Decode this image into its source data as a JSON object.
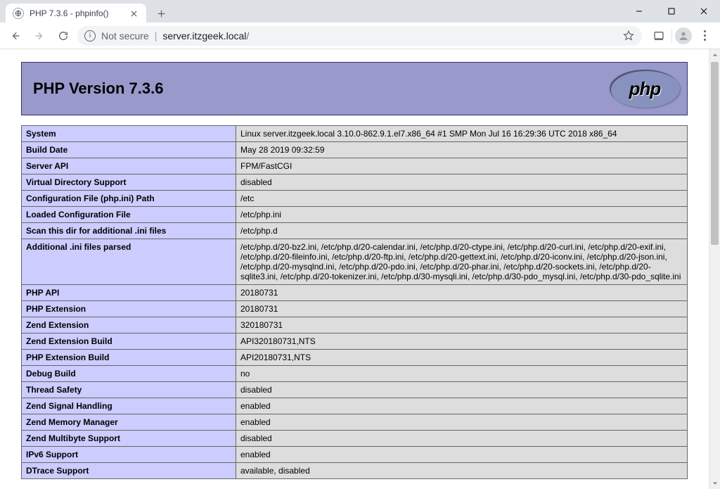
{
  "browser": {
    "tab_title": "PHP 7.3.6 - phpinfo()",
    "not_secure_label": "Not secure",
    "url_host": "server.itzgeek.local",
    "url_path": "/"
  },
  "page": {
    "header_title": "PHP Version 7.3.6",
    "logo_text": "php",
    "rows": [
      {
        "label": "System",
        "value": "Linux server.itzgeek.local 3.10.0-862.9.1.el7.x86_64 #1 SMP Mon Jul 16 16:29:36 UTC 2018 x86_64"
      },
      {
        "label": "Build Date",
        "value": "May 28 2019 09:32:59"
      },
      {
        "label": "Server API",
        "value": "FPM/FastCGI"
      },
      {
        "label": "Virtual Directory Support",
        "value": "disabled"
      },
      {
        "label": "Configuration File (php.ini) Path",
        "value": "/etc"
      },
      {
        "label": "Loaded Configuration File",
        "value": "/etc/php.ini"
      },
      {
        "label": "Scan this dir for additional .ini files",
        "value": "/etc/php.d"
      },
      {
        "label": "Additional .ini files parsed",
        "value": "/etc/php.d/20-bz2.ini, /etc/php.d/20-calendar.ini, /etc/php.d/20-ctype.ini, /etc/php.d/20-curl.ini, /etc/php.d/20-exif.ini, /etc/php.d/20-fileinfo.ini, /etc/php.d/20-ftp.ini, /etc/php.d/20-gettext.ini, /etc/php.d/20-iconv.ini, /etc/php.d/20-json.ini, /etc/php.d/20-mysqlnd.ini, /etc/php.d/20-pdo.ini, /etc/php.d/20-phar.ini, /etc/php.d/20-sockets.ini, /etc/php.d/20-sqlite3.ini, /etc/php.d/20-tokenizer.ini, /etc/php.d/30-mysqli.ini, /etc/php.d/30-pdo_mysql.ini, /etc/php.d/30-pdo_sqlite.ini"
      },
      {
        "label": "PHP API",
        "value": "20180731"
      },
      {
        "label": "PHP Extension",
        "value": "20180731"
      },
      {
        "label": "Zend Extension",
        "value": "320180731"
      },
      {
        "label": "Zend Extension Build",
        "value": "API320180731,NTS"
      },
      {
        "label": "PHP Extension Build",
        "value": "API20180731,NTS"
      },
      {
        "label": "Debug Build",
        "value": "no"
      },
      {
        "label": "Thread Safety",
        "value": "disabled"
      },
      {
        "label": "Zend Signal Handling",
        "value": "enabled"
      },
      {
        "label": "Zend Memory Manager",
        "value": "enabled"
      },
      {
        "label": "Zend Multibyte Support",
        "value": "disabled"
      },
      {
        "label": "IPv6 Support",
        "value": "enabled"
      },
      {
        "label": "DTrace Support",
        "value": "available, disabled"
      }
    ]
  }
}
